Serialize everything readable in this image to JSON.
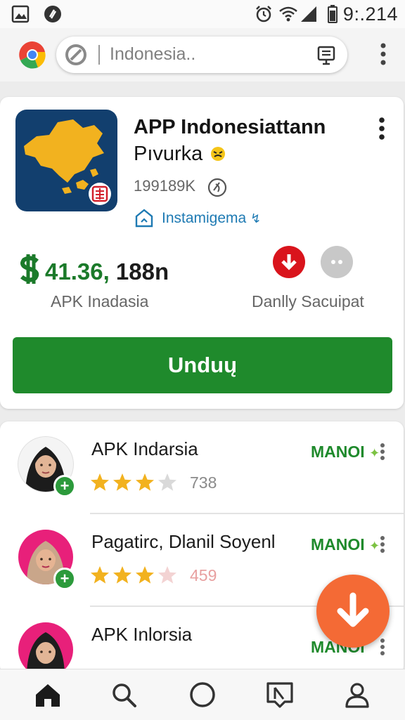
{
  "status_bar": {
    "time": "9:.214"
  },
  "browser": {
    "url_text": "Indonesia..",
    "icons": [
      "gallery-icon",
      "sync-icon",
      "alarm-icon",
      "wifi-icon",
      "signal-icon",
      "battery-icon",
      "chrome-icon",
      "blocked-icon",
      "reader-mode-icon",
      "more-vert-icon"
    ]
  },
  "app": {
    "title_line1": "APP Indonesiattann",
    "title_line2": "Pıvurka",
    "downloads": "199189K",
    "install_text": "Instamigema",
    "price_symbol": "$",
    "price_value": "41.36,",
    "price_suffix": "188n",
    "price_label": "APK Inadasia",
    "daily_label": "Danlly Sacuipat",
    "download_button": "Unduų"
  },
  "list": [
    {
      "name": "APK Indarsia",
      "rating": 3.5,
      "rating_count": "738",
      "badge": "MANOI",
      "avatar_bg": "#ffffff"
    },
    {
      "name": "Pagatirc, Dlanil Soyenl",
      "rating": 3.5,
      "rating_count": "459",
      "badge": "MANOI",
      "avatar_bg": "#e8207a"
    },
    {
      "name": "APK Inlorsia",
      "badge": "MANOI",
      "avatar_bg": "#e8207a"
    }
  ],
  "colors": {
    "accent_green": "#1f8a2c",
    "danger_red": "#d9141c",
    "fab_orange": "#f46a35",
    "link_blue": "#1e7ab3"
  },
  "nav": [
    "home-icon",
    "search-icon",
    "circle-icon",
    "library-icon",
    "profile-icon"
  ]
}
